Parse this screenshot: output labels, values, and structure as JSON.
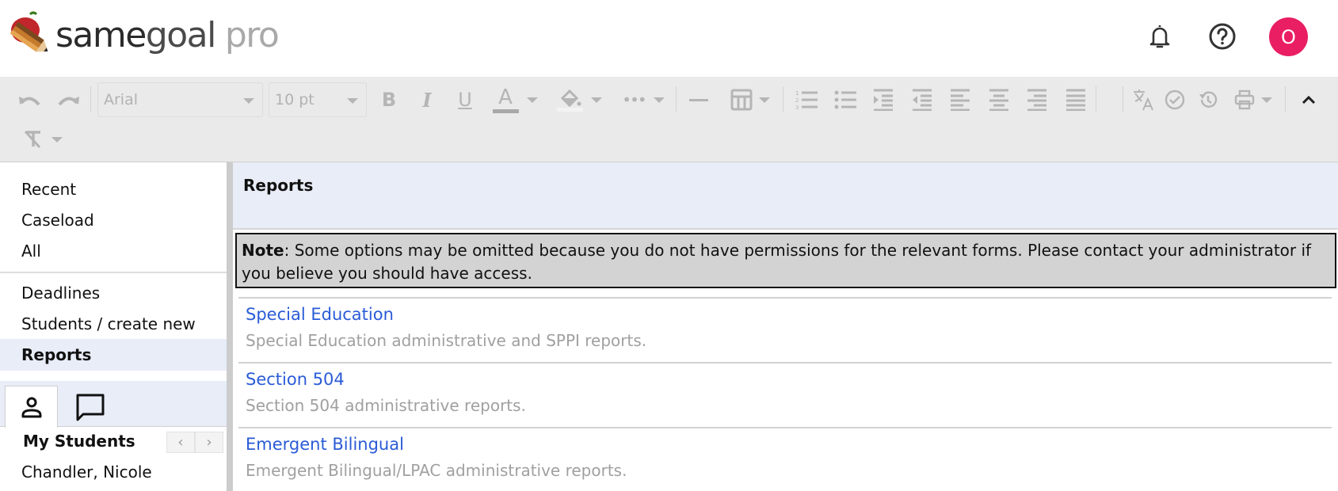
{
  "header": {
    "logo": {
      "same": "same",
      "goal": "goal",
      "pro": "pro"
    },
    "icons": [
      "bell-icon",
      "help-icon"
    ],
    "avatar_initial": "O",
    "avatar_color": "#e91e63"
  },
  "toolbar": {
    "font_family": "Arial",
    "font_size": "10 pt",
    "buttons": [
      "undo",
      "redo",
      "bold",
      "italic",
      "underline",
      "text-color",
      "highlight-color",
      "more",
      "horizontal-rule",
      "table",
      "numbered-list",
      "bullet-list",
      "indent",
      "outdent",
      "align-left",
      "align-center",
      "align-right",
      "justify",
      "translate",
      "spellcheck",
      "history",
      "print",
      "collapse",
      "clear-formatting"
    ]
  },
  "sidebar": {
    "items": [
      {
        "label": "Recent"
      },
      {
        "label": "Caseload"
      },
      {
        "label": "All"
      },
      {
        "label": "Deadlines"
      },
      {
        "label": "Students / create new"
      },
      {
        "label": "Reports",
        "active": true
      }
    ],
    "tabs": [
      "person-icon",
      "chat-icon"
    ],
    "my_students_label": "My Students",
    "pager": {
      "prev": "‹",
      "next": "›"
    },
    "students": [
      "Chandler, Nicole"
    ]
  },
  "main": {
    "title": "Reports",
    "note_label": "Note",
    "note_text": ": Some options may be omitted because you do not have permissions for the relevant forms. Please contact your administrator if you believe you should have access.",
    "reports": [
      {
        "title": "Special Education",
        "description": "Special Education administrative and SPPI reports."
      },
      {
        "title": "Section 504",
        "description": "Section 504 administrative reports."
      },
      {
        "title": "Emergent Bilingual",
        "description": "Emergent Bilingual/LPAC administrative reports."
      }
    ],
    "link_color": "#2a5bd7"
  }
}
